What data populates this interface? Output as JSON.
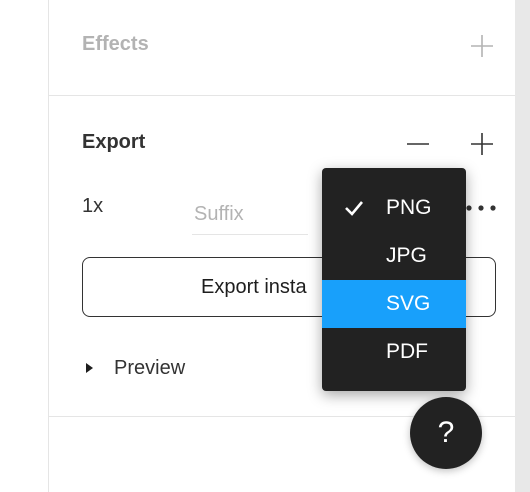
{
  "effects": {
    "title": "Effects"
  },
  "export": {
    "title": "Export",
    "scale": "1x",
    "suffix_placeholder": "Suffix",
    "export_button_label": "Export insta"
  },
  "preview": {
    "label": "Preview"
  },
  "format_menu": {
    "items": [
      {
        "label": "PNG",
        "checked": true,
        "highlighted": false
      },
      {
        "label": "JPG",
        "checked": false,
        "highlighted": false
      },
      {
        "label": "SVG",
        "checked": false,
        "highlighted": true
      },
      {
        "label": "PDF",
        "checked": false,
        "highlighted": false
      }
    ]
  },
  "help": {
    "label": "?"
  },
  "icons": {
    "effects_add": "plus-icon",
    "export_remove": "minus-icon",
    "export_add": "plus-icon",
    "more": "more-dots-icon",
    "preview_toggle": "triangle-right-icon",
    "check": "check-icon"
  },
  "colors": {
    "accent": "#18a0fb",
    "menu_bg": "#222222",
    "muted_text": "#b3b3b3",
    "text": "#333333"
  }
}
